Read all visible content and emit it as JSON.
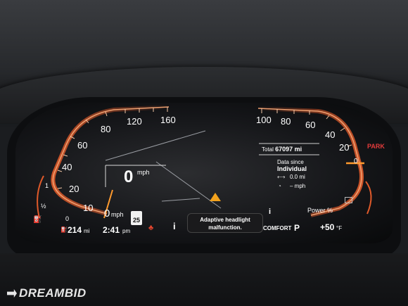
{
  "speedometer": {
    "ticks": [
      "160",
      "120",
      "80",
      "60",
      "40",
      "20",
      "10",
      "0"
    ],
    "unit": "mph",
    "digital_speed": "0",
    "digital_unit": "mph",
    "speed_limit": "25"
  },
  "power_gauge": {
    "ticks": [
      "100",
      "80",
      "60",
      "40",
      "20",
      "0"
    ],
    "label": "Power %",
    "gear": "PARK"
  },
  "trip_info": {
    "total_label": "Total",
    "total_value": "67097 mi",
    "data_since_label": "Data since",
    "data_since_value": "Individual",
    "distance_value": "0.0 mi",
    "speed_value": "– mph"
  },
  "warning": {
    "info_icon": "i",
    "message_line1": "Adaptive headlight",
    "message_line2": "malfunction."
  },
  "status_bar": {
    "range": "214",
    "range_unit": "mi",
    "time": "2:41",
    "time_ampm": "pm",
    "drive_mode": "COMFORT",
    "gear": "P",
    "temperature": "+50",
    "temperature_unit": "°F",
    "info_icon": "i"
  },
  "left_small_gauge": {
    "ticks": [
      "1",
      "½",
      "0"
    ]
  },
  "watermark": {
    "text": "DREAMBID"
  },
  "colors": {
    "gauge_glow": "#e05a2a",
    "needle": "#ff9a2e",
    "warning_triangle": "#f2a21d",
    "park": "#e23b3b",
    "text": "#ffffff"
  }
}
